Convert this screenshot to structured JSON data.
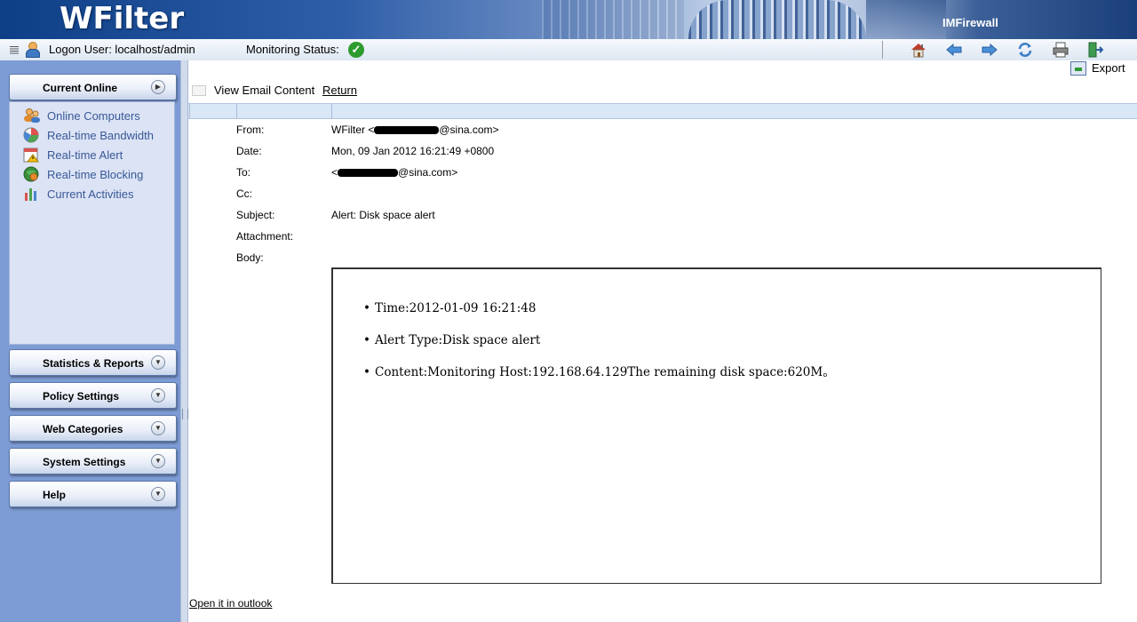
{
  "banner": {
    "logo": "WFilter",
    "brand": "IMFirewall"
  },
  "statusbar": {
    "logon_user": "Logon User: localhost/admin",
    "monitoring_status": "Monitoring Status:",
    "toolbar_icons": [
      "home-icon",
      "back-arrow-icon",
      "forward-arrow-icon",
      "refresh-icon",
      "print-icon",
      "logout-icon"
    ]
  },
  "sidebar": {
    "sections": [
      {
        "label": "Current Online"
      },
      {
        "label": "Statistics & Reports"
      },
      {
        "label": "Policy Settings"
      },
      {
        "label": "Web Categories"
      },
      {
        "label": "System Settings"
      },
      {
        "label": "Help"
      }
    ],
    "current_online_items": [
      {
        "label": "Online Computers",
        "icon": "users-icon"
      },
      {
        "label": "Real-time Bandwidth",
        "icon": "pie-chart-icon"
      },
      {
        "label": "Real-time Alert",
        "icon": "calendar-alert-icon"
      },
      {
        "label": "Real-time Blocking",
        "icon": "globe-block-icon"
      },
      {
        "label": "Current Activities",
        "icon": "bar-chart-icon"
      }
    ]
  },
  "main": {
    "export_label": "Export",
    "page_title": "View Email Content",
    "return_link": "Return",
    "fields": {
      "from_label": "From:",
      "from_prefix": "WFilter <",
      "from_suffix": "@sina.com>",
      "date_label": "Date:",
      "date_value": "Mon, 09 Jan 2012 16:21:49 +0800",
      "to_label": "To:",
      "to_prefix": "<",
      "to_suffix": "@sina.com>",
      "cc_label": "Cc:",
      "subject_label": "Subject:",
      "subject_value": "Alert: Disk space alert",
      "attachment_label": "Attachment:",
      "body_label": "Body:"
    },
    "body_items": [
      "Time:2012-01-09 16:21:48",
      "Alert Type:Disk space alert",
      "Content:Monitoring Host:192.168.64.129The remaining disk space:620M。"
    ],
    "outlook_link": "Open it in outlook"
  },
  "colors": {
    "banner_dark": "#0d3f86",
    "sidebar_bg": "#7d9bd4",
    "submenu_bg": "#dbe3f5",
    "submenu_text": "#3a5897",
    "status_ok": "#2e9b2e"
  }
}
